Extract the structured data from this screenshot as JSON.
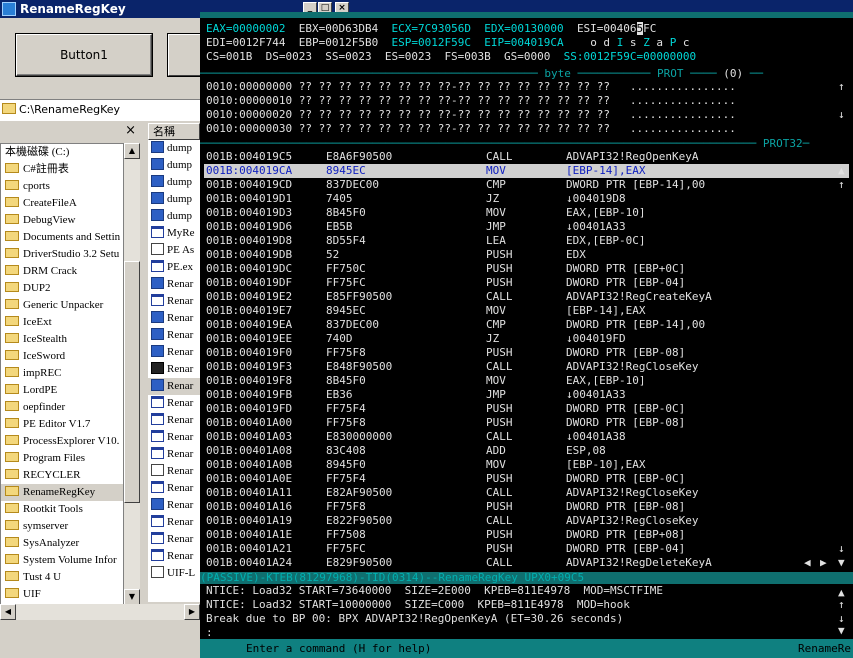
{
  "window_title": "RenameRegKey",
  "window_buttons": {
    "minimize": "_",
    "maximize": "□",
    "close": "×"
  },
  "button1_label": "Button1",
  "address_path": "C:\\RenameRegKey",
  "tree_close": "×",
  "list_header": "名稱",
  "tree_items": [
    {
      "label": "本機磁碟 (C:)",
      "drive": true
    },
    {
      "label": "C#註冊表"
    },
    {
      "label": "cports"
    },
    {
      "label": "CreateFileA"
    },
    {
      "label": "DebugView"
    },
    {
      "label": "Documents and Settin"
    },
    {
      "label": "DriverStudio 3.2 Setu"
    },
    {
      "label": "DRM Crack"
    },
    {
      "label": "DUP2"
    },
    {
      "label": "Generic Unpacker"
    },
    {
      "label": "IceExt"
    },
    {
      "label": "IceStealth"
    },
    {
      "label": "IceSword"
    },
    {
      "label": "impREC"
    },
    {
      "label": "LordPE"
    },
    {
      "label": "oepfinder"
    },
    {
      "label": "PE Editor V1.7"
    },
    {
      "label": "ProcessExplorer V10."
    },
    {
      "label": "Program Files"
    },
    {
      "label": "RECYCLER"
    },
    {
      "label": "RenameRegKey",
      "selected": true
    },
    {
      "label": "Rootkit Tools"
    },
    {
      "label": "symserver"
    },
    {
      "label": "SysAnalyzer"
    },
    {
      "label": "System Volume Infor"
    },
    {
      "label": "Tust 4 U"
    },
    {
      "label": "UIF"
    }
  ],
  "list_items": [
    {
      "label": "dump",
      "icon": "dll"
    },
    {
      "label": "dump",
      "icon": "dll"
    },
    {
      "label": "dump",
      "icon": "dll"
    },
    {
      "label": "dump",
      "icon": "dll"
    },
    {
      "label": "dump",
      "icon": "dll"
    },
    {
      "label": "MyRe",
      "icon": "win"
    },
    {
      "label": "PE As",
      "icon": "doc"
    },
    {
      "label": "PE.ex",
      "icon": "win"
    },
    {
      "label": "Renar",
      "icon": "dll"
    },
    {
      "label": "Renar",
      "icon": "win"
    },
    {
      "label": "Renar",
      "icon": "dll"
    },
    {
      "label": "Renar",
      "icon": "dll"
    },
    {
      "label": "Renar",
      "icon": "dll"
    },
    {
      "label": "Renar",
      "icon": "blk"
    },
    {
      "label": "Renar",
      "icon": "dll",
      "selected": true
    },
    {
      "label": "Renar",
      "icon": "win"
    },
    {
      "label": "Renar",
      "icon": "win"
    },
    {
      "label": "Renar",
      "icon": "win"
    },
    {
      "label": "Renar",
      "icon": "win"
    },
    {
      "label": "Renar",
      "icon": "doc"
    },
    {
      "label": "Renar",
      "icon": "win"
    },
    {
      "label": "Renar",
      "icon": "dll"
    },
    {
      "label": "Renar",
      "icon": "win"
    },
    {
      "label": "Renar",
      "icon": "win"
    },
    {
      "label": "Renar",
      "icon": "win"
    },
    {
      "label": "UIF-L",
      "icon": "doc"
    }
  ],
  "registers": {
    "row1": [
      {
        "text": "EAX=00000002",
        "color": "cy"
      },
      {
        "text": "EBX=00D63DB4",
        "color": "wh"
      },
      {
        "text": "ECX=7C93056D",
        "color": "cy"
      },
      {
        "text": "EDX=00130000",
        "color": "cy"
      },
      {
        "text": "ESI=00406",
        "color": "wh"
      },
      {
        "text": "5",
        "color": "cursor"
      },
      {
        "text": "FC",
        "color": "wh"
      }
    ],
    "row2": [
      {
        "text": "EDI=0012F744",
        "color": "wh"
      },
      {
        "text": "EBP=0012F5B0",
        "color": "wh"
      },
      {
        "text": "ESP=0012F59C",
        "color": "cy"
      },
      {
        "text": "EIP=004019CA",
        "color": "cy"
      },
      {
        "text": "o d ",
        "color": "wh"
      },
      {
        "text": "I",
        "color": "cy"
      },
      {
        "text": " s ",
        "color": "wh"
      },
      {
        "text": "Z",
        "color": "cy"
      },
      {
        "text": " a ",
        "color": "wh"
      },
      {
        "text": "P",
        "color": "cy"
      },
      {
        "text": " c",
        "color": "wh"
      }
    ],
    "row3": [
      {
        "text": "CS=001B",
        "color": "wh"
      },
      {
        "text": "DS=0023",
        "color": "wh"
      },
      {
        "text": "SS=0023",
        "color": "wh"
      },
      {
        "text": "ES=0023",
        "color": "wh"
      },
      {
        "text": "FS=003B",
        "color": "wh"
      },
      {
        "text": "GS=0000",
        "color": "wh"
      },
      {
        "text": "SS:0012F59C=00000000",
        "color": "cy"
      }
    ]
  },
  "data_separator": {
    "byte": "byte",
    "prot": "PROT",
    "index": "(0)"
  },
  "data_rows": [
    {
      "addr": "0010:00000000",
      "hex": "?? ?? ?? ?? ?? ?? ?? ??-?? ?? ?? ?? ?? ?? ?? ??",
      "ascii": "................"
    },
    {
      "addr": "0010:00000010",
      "hex": "?? ?? ?? ?? ?? ?? ?? ??-?? ?? ?? ?? ?? ?? ?? ??",
      "ascii": "................"
    },
    {
      "addr": "0010:00000020",
      "hex": "?? ?? ?? ?? ?? ?? ?? ??-?? ?? ?? ?? ?? ?? ?? ??",
      "ascii": "................"
    },
    {
      "addr": "0010:00000030",
      "hex": "?? ?? ?? ?? ?? ?? ?? ??-?? ?? ?? ?? ?? ?? ?? ??",
      "ascii": "................"
    }
  ],
  "code_separator_label": "PROT32",
  "code_rows": [
    {
      "addr": "001B:004019C5",
      "bytes": "E8A6F90500",
      "mnem": "CALL",
      "ops": "ADVAPI32!RegOpenKeyA"
    },
    {
      "addr": "001B:004019CA",
      "bytes": "8945EC",
      "mnem": "MOV",
      "ops": "[EBP-14],EAX",
      "current": true
    },
    {
      "addr": "001B:004019CD",
      "bytes": "837DEC00",
      "mnem": "CMP",
      "ops": "DWORD PTR [EBP-14],00"
    },
    {
      "addr": "001B:004019D1",
      "bytes": "7405",
      "mnem": "JZ",
      "ops": "↓004019D8"
    },
    {
      "addr": "001B:004019D3",
      "bytes": "8B45F0",
      "mnem": "MOV",
      "ops": "EAX,[EBP-10]"
    },
    {
      "addr": "001B:004019D6",
      "bytes": "EB5B",
      "mnem": "JMP",
      "ops": "↓00401A33"
    },
    {
      "addr": "001B:004019D8",
      "bytes": "8D55F4",
      "mnem": "LEA",
      "ops": "EDX,[EBP-0C]"
    },
    {
      "addr": "001B:004019DB",
      "bytes": "52",
      "mnem": "PUSH",
      "ops": "EDX"
    },
    {
      "addr": "001B:004019DC",
      "bytes": "FF750C",
      "mnem": "PUSH",
      "ops": "DWORD PTR [EBP+0C]"
    },
    {
      "addr": "001B:004019DF",
      "bytes": "FF75FC",
      "mnem": "PUSH",
      "ops": "DWORD PTR [EBP-04]"
    },
    {
      "addr": "001B:004019E2",
      "bytes": "E85FF90500",
      "mnem": "CALL",
      "ops": "ADVAPI32!RegCreateKeyA"
    },
    {
      "addr": "001B:004019E7",
      "bytes": "8945EC",
      "mnem": "MOV",
      "ops": "[EBP-14],EAX"
    },
    {
      "addr": "001B:004019EA",
      "bytes": "837DEC00",
      "mnem": "CMP",
      "ops": "DWORD PTR [EBP-14],00"
    },
    {
      "addr": "001B:004019EE",
      "bytes": "740D",
      "mnem": "JZ",
      "ops": "↓004019FD"
    },
    {
      "addr": "001B:004019F0",
      "bytes": "FF75F8",
      "mnem": "PUSH",
      "ops": "DWORD PTR [EBP-08]"
    },
    {
      "addr": "001B:004019F3",
      "bytes": "E848F90500",
      "mnem": "CALL",
      "ops": "ADVAPI32!RegCloseKey"
    },
    {
      "addr": "001B:004019F8",
      "bytes": "8B45F0",
      "mnem": "MOV",
      "ops": "EAX,[EBP-10]"
    },
    {
      "addr": "001B:004019FB",
      "bytes": "EB36",
      "mnem": "JMP",
      "ops": "↓00401A33"
    },
    {
      "addr": "001B:004019FD",
      "bytes": "FF75F4",
      "mnem": "PUSH",
      "ops": "DWORD PTR [EBP-0C]"
    },
    {
      "addr": "001B:00401A00",
      "bytes": "FF75F8",
      "mnem": "PUSH",
      "ops": "DWORD PTR [EBP-08]"
    },
    {
      "addr": "001B:00401A03",
      "bytes": "E830000000",
      "mnem": "CALL",
      "ops": "↓00401A38"
    },
    {
      "addr": "001B:00401A08",
      "bytes": "83C408",
      "mnem": "ADD",
      "ops": "ESP,08"
    },
    {
      "addr": "001B:00401A0B",
      "bytes": "8945F0",
      "mnem": "MOV",
      "ops": "[EBP-10],EAX"
    },
    {
      "addr": "001B:00401A0E",
      "bytes": "FF75F4",
      "mnem": "PUSH",
      "ops": "DWORD PTR [EBP-0C]"
    },
    {
      "addr": "001B:00401A11",
      "bytes": "E82AF90500",
      "mnem": "CALL",
      "ops": "ADVAPI32!RegCloseKey"
    },
    {
      "addr": "001B:00401A16",
      "bytes": "FF75F8",
      "mnem": "PUSH",
      "ops": "DWORD PTR [EBP-08]"
    },
    {
      "addr": "001B:00401A19",
      "bytes": "E822F90500",
      "mnem": "CALL",
      "ops": "ADVAPI32!RegCloseKey"
    },
    {
      "addr": "001B:00401A1E",
      "bytes": "FF7508",
      "mnem": "PUSH",
      "ops": "DWORD PTR [EBP+08]"
    },
    {
      "addr": "001B:00401A21",
      "bytes": "FF75FC",
      "mnem": "PUSH",
      "ops": "DWORD PTR [EBP-04]"
    },
    {
      "addr": "001B:00401A24",
      "bytes": "E829F90500",
      "mnem": "CALL",
      "ops": "ADVAPI32!RegDeleteKeyA"
    }
  ],
  "status_line": "(PASSIVE)-KTEB(81297968)-TID(0314)--RenameRegKey UPX0+09C5",
  "log_lines": [
    "NTICE: Load32 START=73640000  SIZE=2E000  KPEB=811E4978  MOD=MSCTFIME",
    "NTICE: Load32 START=10000000  SIZE=C000  KPEB=811E4978  MOD=hook",
    "Break due to BP 00: BPX ADVAPI32!RegOpenKeyA (ET=30.26 seconds)"
  ],
  "prompt": ":",
  "command_hint": "Enter a command (H for help)",
  "command_process": "RenameRe",
  "colors": {
    "sice_bg": "#000000",
    "accent": "#0f8080",
    "highlight": "#d0d0d0",
    "title": "#0a246a"
  }
}
